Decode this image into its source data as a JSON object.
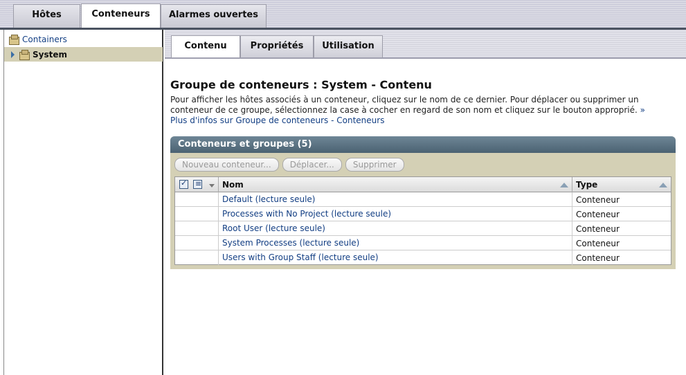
{
  "top_tabs": [
    {
      "label": "Hôtes",
      "active": false
    },
    {
      "label": "Conteneurs",
      "active": true
    },
    {
      "label": "Alarmes ouvertes",
      "active": false
    }
  ],
  "tree": {
    "root_label": "Containers",
    "selected_label": "System"
  },
  "sub_tabs": [
    {
      "label": "Contenu",
      "active": true
    },
    {
      "label": "Propriétés",
      "active": false
    },
    {
      "label": "Utilisation",
      "active": false
    }
  ],
  "page": {
    "title": "Groupe de conteneurs : System - Contenu",
    "help_text": "Pour afficher les hôtes associés à un conteneur, cliquez sur le nom de ce dernier. Pour déplacer ou supprimer un conteneur de ce groupe, sélectionnez la case à cocher en regard de son nom et cliquez sur le bouton approprié.",
    "more_info_arrow": "»",
    "more_info_link": "Plus d'infos sur Groupe de conteneurs - Conteneurs"
  },
  "table": {
    "title": "Conteneurs et groupes (5)",
    "buttons": {
      "new": "Nouveau conteneur...",
      "move": "Déplacer...",
      "delete": "Supprimer"
    },
    "columns": {
      "name": "Nom",
      "type": "Type"
    },
    "rows": [
      {
        "name": "Default (lecture seule)",
        "type": "Conteneur"
      },
      {
        "name": "Processes with No Project (lecture seule)",
        "type": "Conteneur"
      },
      {
        "name": "Root User (lecture seule)",
        "type": "Conteneur"
      },
      {
        "name": "System Processes (lecture seule)",
        "type": "Conteneur"
      },
      {
        "name": "Users with Group Staff (lecture seule)",
        "type": "Conteneur"
      }
    ]
  },
  "colors": {
    "link": "#123e83",
    "selection": "#d4d0b5",
    "table_header": "#5a7282"
  }
}
